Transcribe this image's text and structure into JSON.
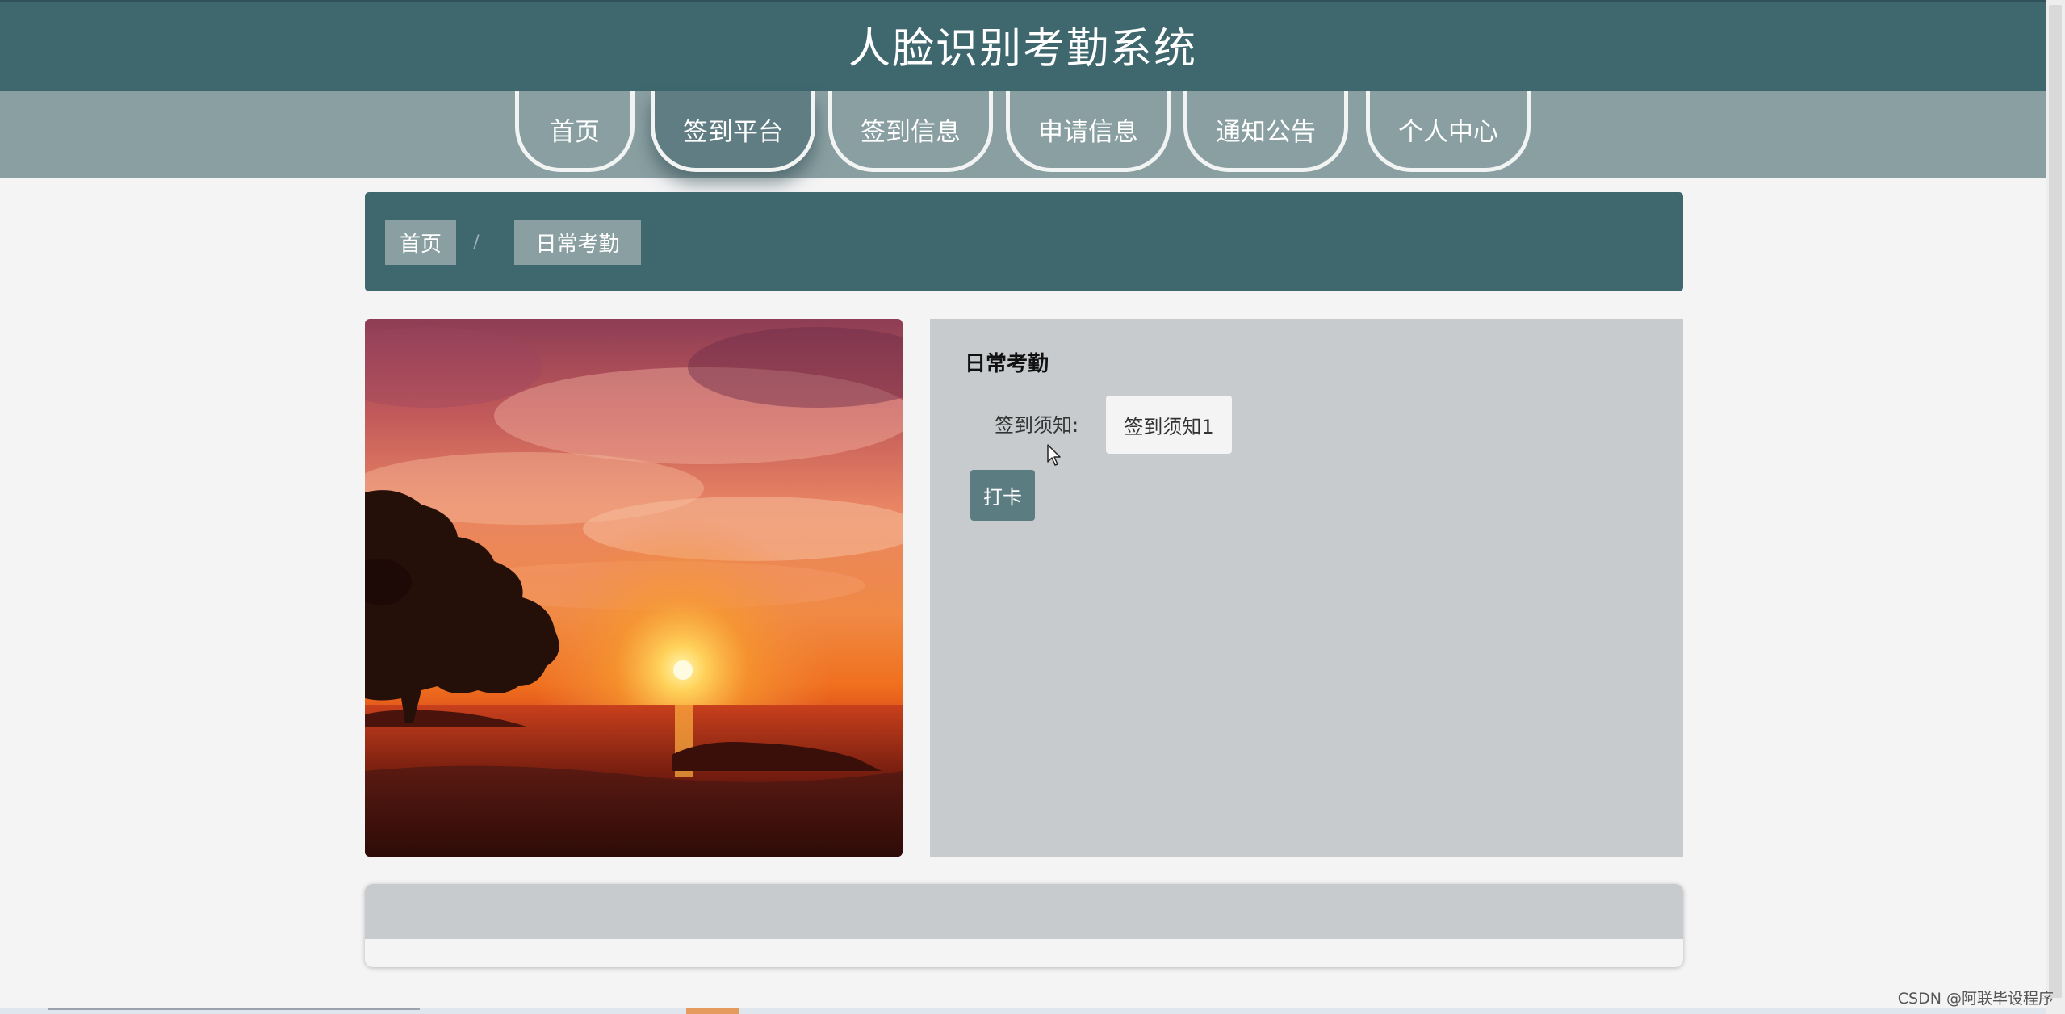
{
  "header": {
    "title": "人脸识别考勤系统"
  },
  "nav": {
    "items": [
      {
        "label": "首页"
      },
      {
        "label": "签到平台"
      },
      {
        "label": "签到信息"
      },
      {
        "label": "申请信息"
      },
      {
        "label": "通知公告"
      },
      {
        "label": "个人中心"
      }
    ],
    "active_index": 1
  },
  "breadcrumb": {
    "home": "首页",
    "separator": "/",
    "current": "日常考勤"
  },
  "form": {
    "title": "日常考勤",
    "notice_label": "签到须知:",
    "notice_value": "签到须知1",
    "checkin_button": "打卡"
  },
  "watermark": "CSDN @阿联毕设程序",
  "colors": {
    "header": "#3e676e",
    "nav": "#8a9fa2",
    "panel": "#c7cbcd",
    "button": "#5b7c80"
  },
  "icons": {
    "photo": "sunset-photo",
    "pointer": "mouse-cursor-icon"
  }
}
